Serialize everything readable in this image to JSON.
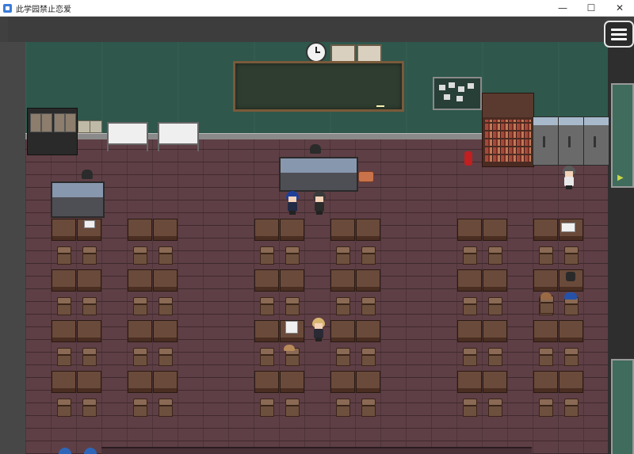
{
  "window": {
    "title": "此学园禁止恋爱",
    "app_icon": "app-icon",
    "controls": {
      "minimize": "—",
      "maximize": "☐",
      "close": "✕"
    }
  },
  "game": {
    "menu_icon": "hamburger-menu-icon",
    "exit_arrow": "▶",
    "scene": "classroom"
  },
  "colors": {
    "wall": "#2f574c",
    "floor": "#5e3f45",
    "desk": "#6a4a3a",
    "accent_arrow": "#c8d74a"
  }
}
